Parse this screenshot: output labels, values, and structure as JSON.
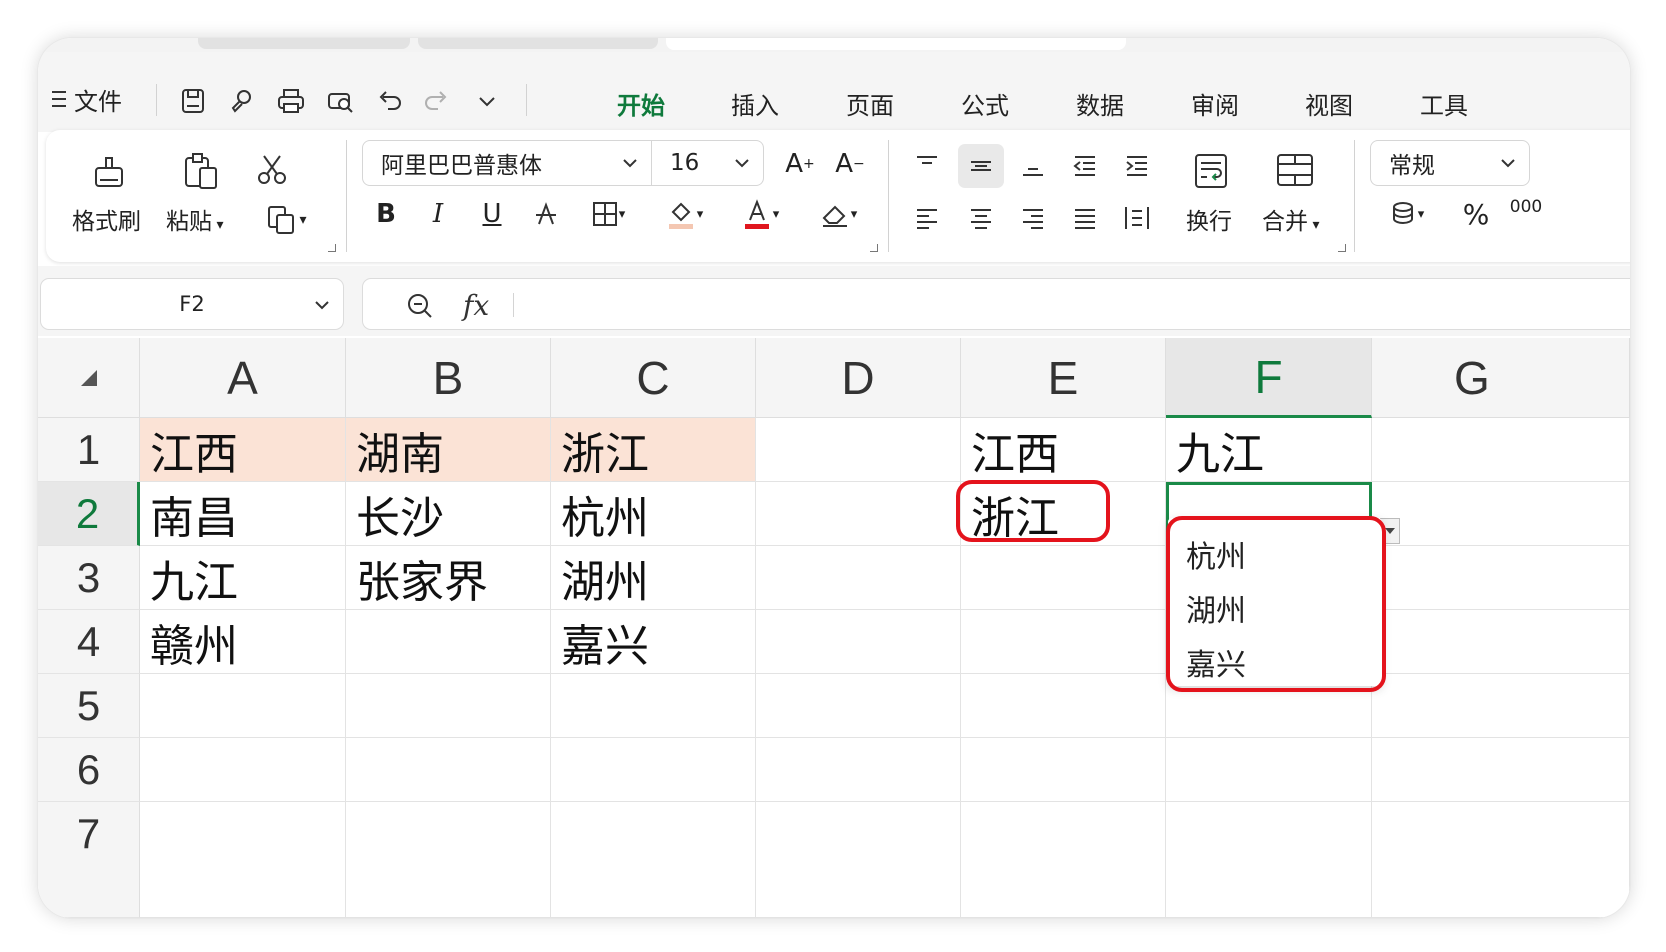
{
  "menubar": {
    "file_label": "文件",
    "quick_access": [
      "save-icon",
      "brush-icon",
      "print-icon",
      "print-preview-icon",
      "undo-icon",
      "redo-icon",
      "chevron-down-icon"
    ],
    "tabs": [
      {
        "label": "开始",
        "active": true
      },
      {
        "label": "插入",
        "active": false
      },
      {
        "label": "页面",
        "active": false
      },
      {
        "label": "公式",
        "active": false
      },
      {
        "label": "数据",
        "active": false
      },
      {
        "label": "审阅",
        "active": false
      },
      {
        "label": "视图",
        "active": false
      },
      {
        "label": "工具",
        "active": false
      }
    ]
  },
  "ribbon": {
    "format_painter_label": "格式刷",
    "paste_label": "粘贴",
    "font_name": "阿里巴巴普惠体",
    "font_size": "16",
    "bold": "B",
    "italic": "I",
    "underline": "U",
    "wrap_label": "换行",
    "merge_label": "合并",
    "number_format": "常规",
    "percent": "%",
    "thousands": "000",
    "font_color": "#e0161e",
    "fill_color": "#f4c7b2"
  },
  "formula_bar": {
    "name_box": "F2",
    "fx_label": "fx",
    "formula": ""
  },
  "sheet": {
    "columns": [
      "A",
      "B",
      "C",
      "D",
      "E",
      "F",
      "G"
    ],
    "active_column": "F",
    "rows": [
      "1",
      "2",
      "3",
      "4",
      "5",
      "6",
      "7"
    ],
    "active_row": "2",
    "cells": {
      "A1": "江西",
      "B1": "湖南",
      "C1": "浙江",
      "E1": "江西",
      "F1": "九江",
      "A2": "南昌",
      "B2": "长沙",
      "C2": "杭州",
      "E2": "浙江",
      "A3": "九江",
      "B3": "张家界",
      "C3": "湖州",
      "A4": "赣州",
      "C4": "嘉兴"
    },
    "header_fill": "#fbe3d6",
    "accent": "#1a8a48"
  },
  "dropdown": {
    "options": [
      "杭州",
      "湖州",
      "嘉兴"
    ]
  },
  "annotation_color": "#e4131c"
}
